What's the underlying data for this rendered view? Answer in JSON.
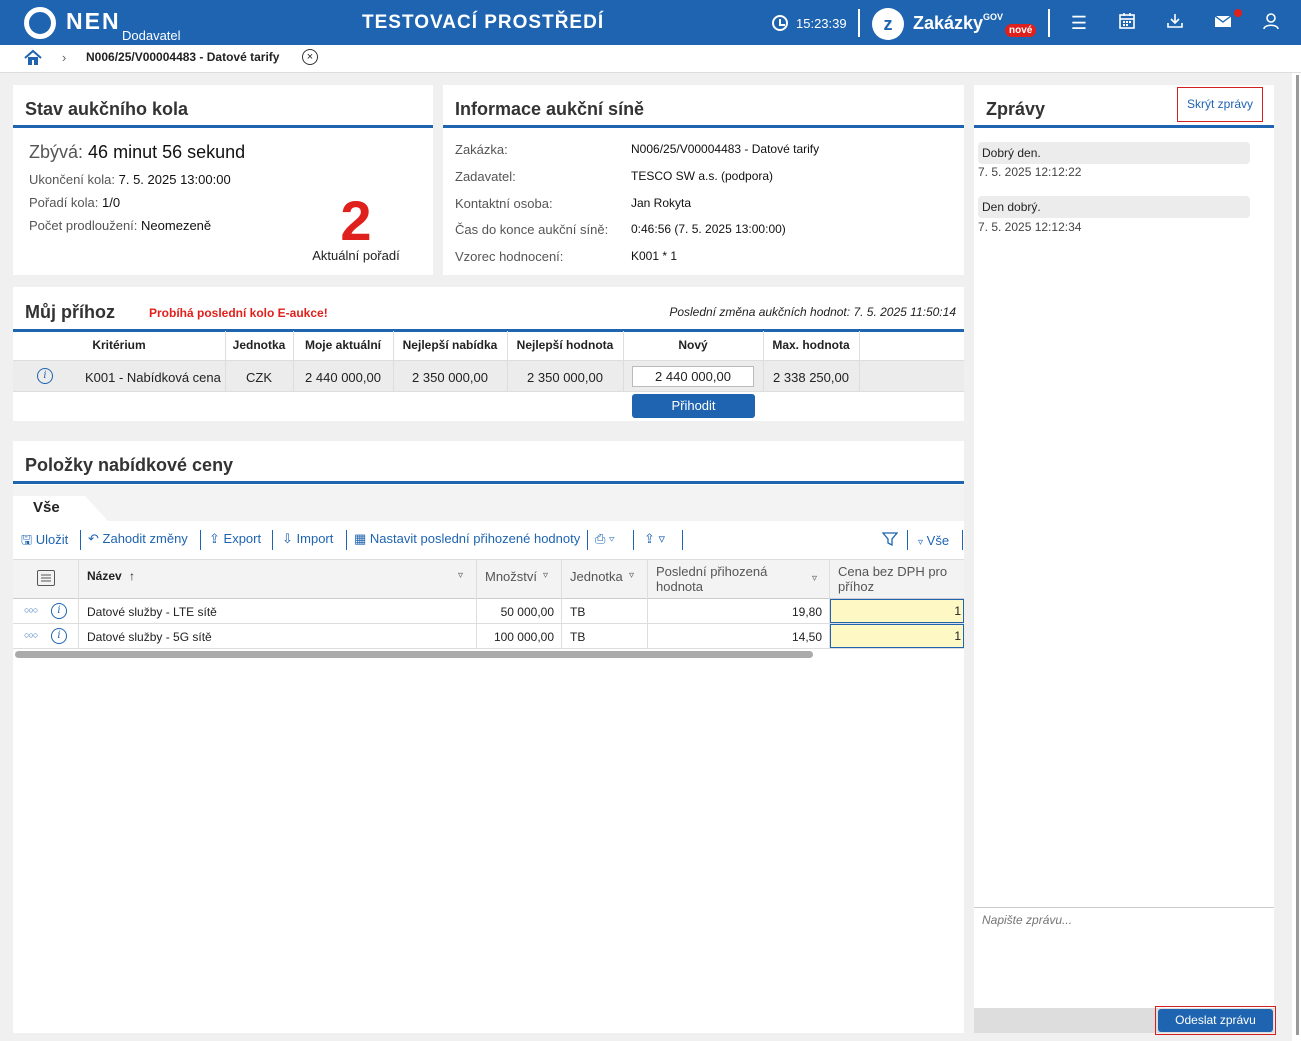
{
  "header": {
    "logo_text": "NEN",
    "logo_sub": "Dodavatel",
    "env_title": "TESTOVACÍ PROSTŘEDÍ",
    "clock_time": "15:23:39",
    "zakazky_label": "Zakázky",
    "zakazky_gov": "GOV",
    "zakazky_badge": "nové"
  },
  "breadcrumb": {
    "current": "N006/25/V00004483 - Datové tarify"
  },
  "stav": {
    "title": "Stav aukčního kola",
    "remaining_label": "Zbývá:",
    "remaining_value": "46 minut 56 sekund",
    "end_label": "Ukončení kola:",
    "end_value": "7. 5. 2025 13:00:00",
    "order_label": "Pořadí kola:",
    "order_value": "1/0",
    "ext_label": "Počet prodloužení:",
    "ext_value": "Neomezeně",
    "rank_value": "2",
    "rank_label": "Aktuální pořadí"
  },
  "info": {
    "title": "Informace aukční síně",
    "rows": [
      {
        "label": "Zakázka:",
        "value": "N006/25/V00004483 - Datové tarify"
      },
      {
        "label": "Zadavatel:",
        "value": "TESCO SW a.s. (podpora)"
      },
      {
        "label": "Kontaktní osoba:",
        "value": "Jan Rokyta"
      },
      {
        "label": "Čas do konce aukční síně:",
        "value": "0:46:56 (7. 5. 2025 13:00:00)"
      },
      {
        "label": "Vzorec hodnocení:",
        "value": "K001 * 1"
      }
    ]
  },
  "bid": {
    "title": "Můj příhoz",
    "alert": "Probíhá poslední kolo E-aukce!",
    "last_change_label": "Poslední změna aukčních hodnot:",
    "last_change_value": "7. 5. 2025 11:50:14",
    "columns": [
      "Kritérium",
      "Jednotka",
      "Moje aktuální",
      "Nejlepší nabídka",
      "Nejlepší hodnota",
      "Nový",
      "Max. hodnota"
    ],
    "row": {
      "criterion": "K001 - Nabídková cena",
      "unit": "CZK",
      "mine": "2 440 000,00",
      "best_offer": "2 350 000,00",
      "best_value": "2 350 000,00",
      "new_value": "2 440 000,00",
      "max_value": "2 338 250,00"
    },
    "submit_label": "Přihodit"
  },
  "items": {
    "title": "Položky nabídkové ceny",
    "tab_all": "Vše",
    "toolbar": {
      "save": "Uložit",
      "discard": "Zahodit změny",
      "export": "Export",
      "import": "Import",
      "set_last": "Nastavit poslední přihozené hodnoty",
      "filter_all": "Vše"
    },
    "columns": {
      "name": "Název",
      "qty": "Množství",
      "unit": "Jednotka",
      "last": "Poslední přihozená hodnota",
      "price": "Cena bez DPH pro příhoz"
    },
    "rows": [
      {
        "name": "Datové služby - LTE sítě",
        "qty": "50 000,00",
        "unit": "TB",
        "last": "19,80",
        "price": "1"
      },
      {
        "name": "Datové služby - 5G sítě",
        "qty": "100 000,00",
        "unit": "TB",
        "last": "14,50",
        "price": "1"
      }
    ]
  },
  "messages": {
    "title": "Zprávy",
    "hide_label": "Skrýt zprávy",
    "list": [
      {
        "text": "Dobrý den.",
        "time": "7. 5. 2025 12:12:22"
      },
      {
        "text": "Den dobrý.",
        "time": "7. 5. 2025 12:12:34"
      }
    ],
    "placeholder": "Napište zprávu...",
    "send_label": "Odeslat zprávu"
  }
}
